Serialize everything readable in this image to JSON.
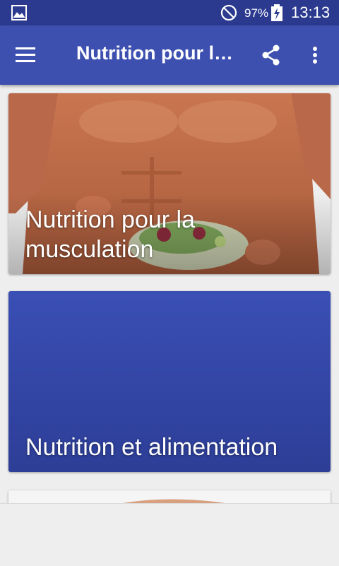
{
  "status_bar": {
    "battery": "97%",
    "time": "13:13",
    "icons": [
      "image-icon",
      "do-not-disturb-icon",
      "battery-charging-icon"
    ]
  },
  "app_bar": {
    "title": "Nutrition pour la musculation",
    "icons": [
      "menu-icon",
      "share-icon",
      "more-vert-icon"
    ]
  },
  "cards": [
    {
      "title": "Nutrition pour la musculation",
      "image": "muscular-torso-with-salad-bowl"
    },
    {
      "title": "Nutrition et alimentation",
      "image": "blue-gradient"
    },
    {
      "title": "",
      "image": "partial-photo"
    }
  ],
  "colors": {
    "status_bar": "#2b3a8f",
    "app_bar": "#3d50b0",
    "background": "#eeeeee"
  }
}
